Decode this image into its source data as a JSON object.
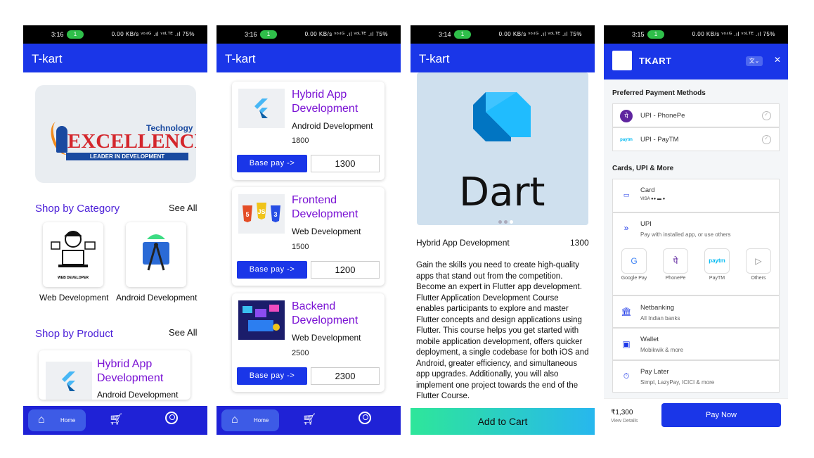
{
  "status": {
    "s1_time": "3:16",
    "s2_time": "3:16",
    "s3_time": "3:14",
    "s4_time": "3:15",
    "pill": "1",
    "icons_text": "0.00 KB/s ᵛᵒ⁴ᴳ .ıl ᵛᵒᴸᵀᴱ .ıl 75%"
  },
  "app": {
    "title": "T-kart"
  },
  "nav": {
    "home_label": "Home",
    "home_icon": "home-icon",
    "cart_icon": "cart-icon",
    "profile_icon": "profile-icon"
  },
  "screen1": {
    "banner": {
      "technology": "Technology",
      "excellence": "EXCELLENCE",
      "tagline": "LEADER IN DEVELOPMENT"
    },
    "shop_by_category": "Shop by Category",
    "see_all": "See All",
    "categories": [
      {
        "label": "Web Development",
        "icon_caption": "WEB DEVELOPER"
      },
      {
        "label": "Android Development"
      }
    ],
    "shop_by_product": "Shop by Product",
    "product": {
      "title_line1": "Hybrid App",
      "title_line2": "Development",
      "category": "Android Development"
    }
  },
  "screen2": {
    "products": [
      {
        "title_line1": "Hybrid App",
        "title_line2": "Development",
        "category": "Android Development",
        "base_price": "1800",
        "button": "Base pay ->",
        "pay": "1300"
      },
      {
        "title_line1": "Frontend",
        "title_line2": "Development",
        "category": "Web Development",
        "base_price": "1500",
        "button": "Base pay ->",
        "pay": "1200"
      },
      {
        "title_line1": "Backend",
        "title_line2": "Development",
        "category": "Web Development",
        "base_price": "2500",
        "button": "Base pay ->",
        "pay": "2300"
      }
    ]
  },
  "screen3": {
    "hero_word": "Dart",
    "title": "Hybrid App Development",
    "price": "1300",
    "description": "Gain the skills you need to create high-quality apps that stand out from the competition. Become an expert in Flutter app development. Flutter Application Development Course enables participants to explore and master Flutter concepts and design applications using Flutter. This course helps you get started with mobile application development, offers quicker deployment, a single codebase for both iOS and Android, greater efficiency, and simultaneous app upgrades. Additionally, you will also implement one project towards the end of the Flutter Course.",
    "add_to_cart": "Add to Cart"
  },
  "screen4": {
    "brand": "TKART",
    "preferred_heading": "Preferred Payment Methods",
    "preferred": [
      "UPI - PhonePe",
      "UPI - PayTM"
    ],
    "cards_heading": "Cards, UPI & More",
    "card_label": "Card",
    "upi_label": "UPI",
    "upi_sub": "Pay with installed app, or use others",
    "upi_apps": [
      "Google Pay",
      "PhonePe",
      "PayTM",
      "Others"
    ],
    "paytm_logo": "paytm",
    "netbanking": "Netbanking",
    "netbanking_sub": "All Indian banks",
    "wallet": "Wallet",
    "wallet_sub": "Mobikwik & more",
    "paylater": "Pay Later",
    "paylater_sub": "Simpl, LazyPay, ICICI & more",
    "amount": "₹1,300",
    "view_details": "View Details",
    "pay_now": "Pay Now"
  }
}
